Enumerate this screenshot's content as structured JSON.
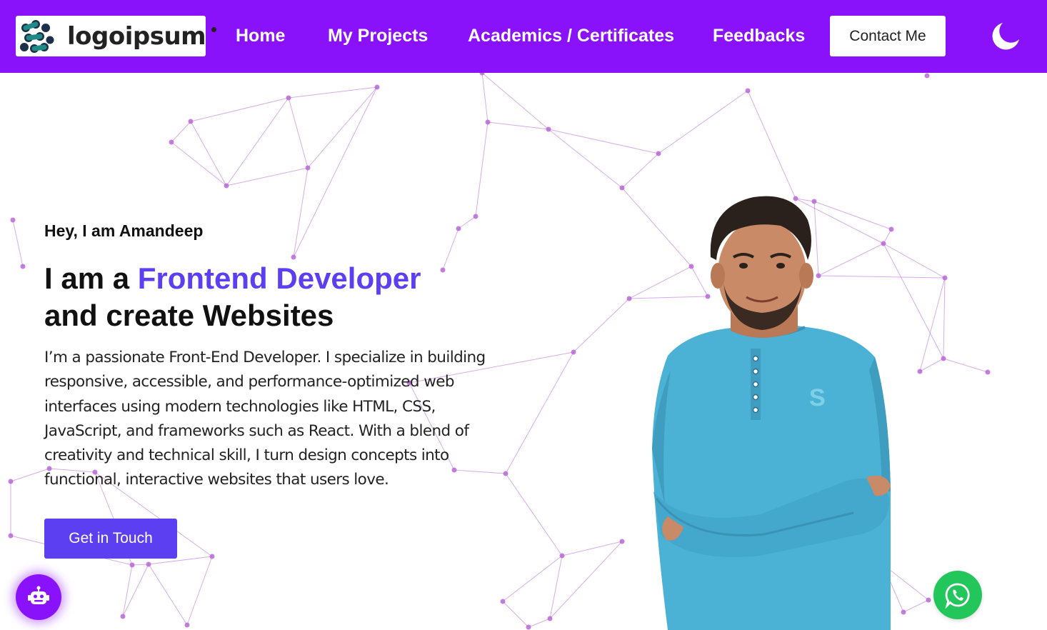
{
  "brand": {
    "logo_text": "logoipsum"
  },
  "nav": {
    "links": [
      "Home",
      "My Projects",
      "Academics / Certificates",
      "Feedbacks"
    ],
    "contact_label": "Contact Me",
    "theme_icon": "moon-icon"
  },
  "hero": {
    "greeting": "Hey, I am Amandeep",
    "headline_prefix": "I am a",
    "headline_accent": "Frontend Developer",
    "headline_suffix": "and create Websites",
    "bio": "I’m a passionate Front-End Developer. I specialize in building responsive, accessible, and performance-optimized web interfaces using modern technologies like HTML, CSS, JavaScript, and frameworks such as React. With a blend of creativity and technical skill, I turn design concepts into functional, interactive websites that users love.",
    "cta_label": "Get in Touch"
  },
  "floating": {
    "chatbot_icon": "robot-icon",
    "whatsapp_icon": "whatsapp-icon"
  },
  "colors": {
    "nav_bg": "#8a12fb",
    "accent": "#5b3ff0",
    "network": "#b768d6",
    "whatsapp": "#23c65b",
    "shirt": "#4bb2d6"
  }
}
